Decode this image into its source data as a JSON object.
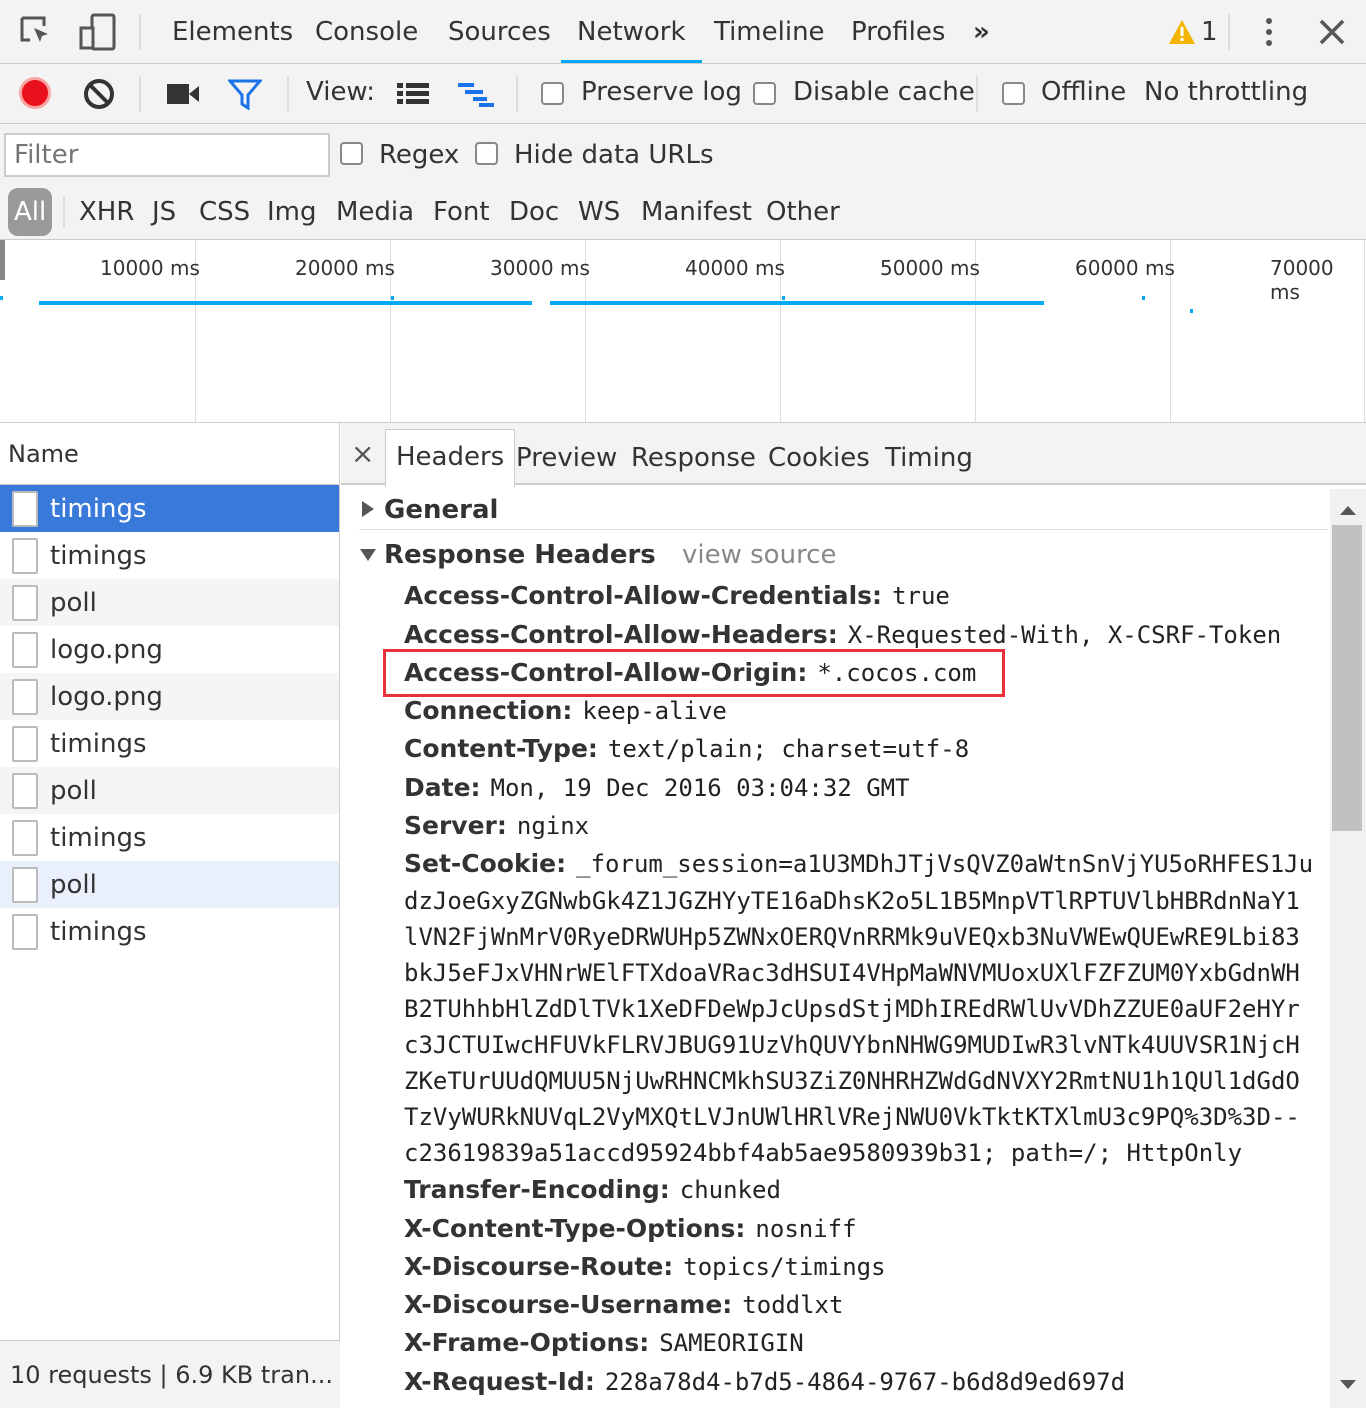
{
  "tabs": [
    "Elements",
    "Console",
    "Sources",
    "Network",
    "Timeline",
    "Profiles"
  ],
  "more": "»",
  "warnings": "1",
  "toolbar": {
    "view_label": "View:",
    "preserve_log": "Preserve log",
    "disable_cache": "Disable cache",
    "offline": "Offline",
    "throttling": "No throttling"
  },
  "filter": {
    "placeholder": "Filter",
    "regex": "Regex",
    "hide_data": "Hide data URLs"
  },
  "types": [
    "All",
    "XHR",
    "JS",
    "CSS",
    "Img",
    "Media",
    "Font",
    "Doc",
    "WS",
    "Manifest",
    "Other"
  ],
  "overview": {
    "ticks": [
      "10000 ms",
      "20000 ms",
      "30000 ms",
      "40000 ms",
      "50000 ms",
      "60000 ms",
      "70000 ms"
    ]
  },
  "requests": {
    "header": "Name",
    "items": [
      "timings",
      "timings",
      "poll",
      "logo.png",
      "logo.png",
      "timings",
      "poll",
      "timings",
      "poll",
      "timings"
    ],
    "status": "10 requests  |  6.9 KB tran..."
  },
  "detail": {
    "close": "×",
    "tabs": [
      "Headers",
      "Preview",
      "Response",
      "Cookies",
      "Timing"
    ],
    "general": "General",
    "response_headers": "Response Headers",
    "view_source": "view source",
    "headers": [
      {
        "k": "Access-Control-Allow-Credentials:",
        "v": "true"
      },
      {
        "k": "Access-Control-Allow-Headers:",
        "v": "X-Requested-With, X-CSRF-Token"
      },
      {
        "k": "Access-Control-Allow-Origin:",
        "v": "*.cocos.com"
      },
      {
        "k": "Connection:",
        "v": "keep-alive"
      },
      {
        "k": "Content-Type:",
        "v": "text/plain; charset=utf-8"
      },
      {
        "k": "Date:",
        "v": "Mon, 19 Dec 2016 03:04:32 GMT"
      },
      {
        "k": "Server:",
        "v": "nginx"
      },
      {
        "k": "Set-Cookie:",
        "v": "_forum_session=a1U3MDhJTjVsQVZ0aWtnSnVjYU5oRHFES1Ju"
      }
    ],
    "cookie_lines": [
      "dzJoeGxyZGNwbGk4Z1JGZHYyTE16aDhsK2o5L1B5MnpVTlRPTUVlbHBRdnNaY1",
      "lVN2FjWnMrV0RyeDRWUHp5ZWNxOERQVnRRMk9uVEQxb3NuVWEwQUEwRE9Lbi83",
      "bkJ5eFJxVHNrWElFTXdoaVRac3dHSUI4VHpMaWNVMUoxUXlFZFZUM0YxbGdnWH",
      "B2TUhhbHlZdDlTVk1XeDFDeWpJcUpsdStjMDhIREdRWlUvVDhZZUE0aUF2eHYr",
      "c3JCTUIwcHFUVkFLRVJBUG91UzVhQUVYbnNHWG9MUDIwR3lvNTk4UUVSR1NjcH",
      "ZKeTUrUUdQMUU5NjUwRHNCMkhSU3ZiZ0NHRHZWdGdNVXY2RmtNU1h1QUl1dGdO",
      "TzVyWURkNUVqL2VyMXQtLVJnUWlHRlVRejNWU0VkTktKTXlmU3c9PQ%3D%3D--",
      "c23619839a51accd95924bbf4ab5ae9580939b31; path=/; HttpOnly"
    ],
    "headers2": [
      {
        "k": "Transfer-Encoding:",
        "v": "chunked"
      },
      {
        "k": "X-Content-Type-Options:",
        "v": "nosniff"
      },
      {
        "k": "X-Discourse-Route:",
        "v": "topics/timings"
      },
      {
        "k": "X-Discourse-Username:",
        "v": "toddlxt"
      },
      {
        "k": "X-Frame-Options:",
        "v": "SAMEORIGIN"
      },
      {
        "k": "X-Request-Id:",
        "v": "228a78d4-b7d5-4864-9767-b6d8d9ed697d"
      }
    ]
  }
}
